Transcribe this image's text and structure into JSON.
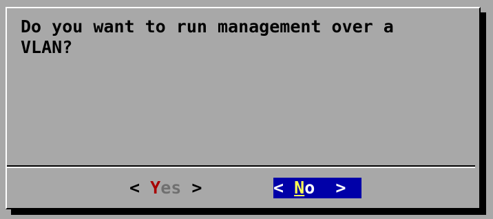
{
  "dialog": {
    "message": "Do you want to run management over a\nVLAN?"
  },
  "buttons": {
    "yes": {
      "left_bracket": "<",
      "hotkey": "Y",
      "rest": "es",
      "right_bracket": ">"
    },
    "no": {
      "left_bracket": "<",
      "hotkey": "N",
      "rest": "o",
      "right_bracket": ">"
    }
  },
  "colors": {
    "background": "#a8a8a8",
    "selected_button_bg": "#0000a8",
    "hotkey_inactive": "#a80000",
    "hotkey_active": "#ffff54"
  }
}
